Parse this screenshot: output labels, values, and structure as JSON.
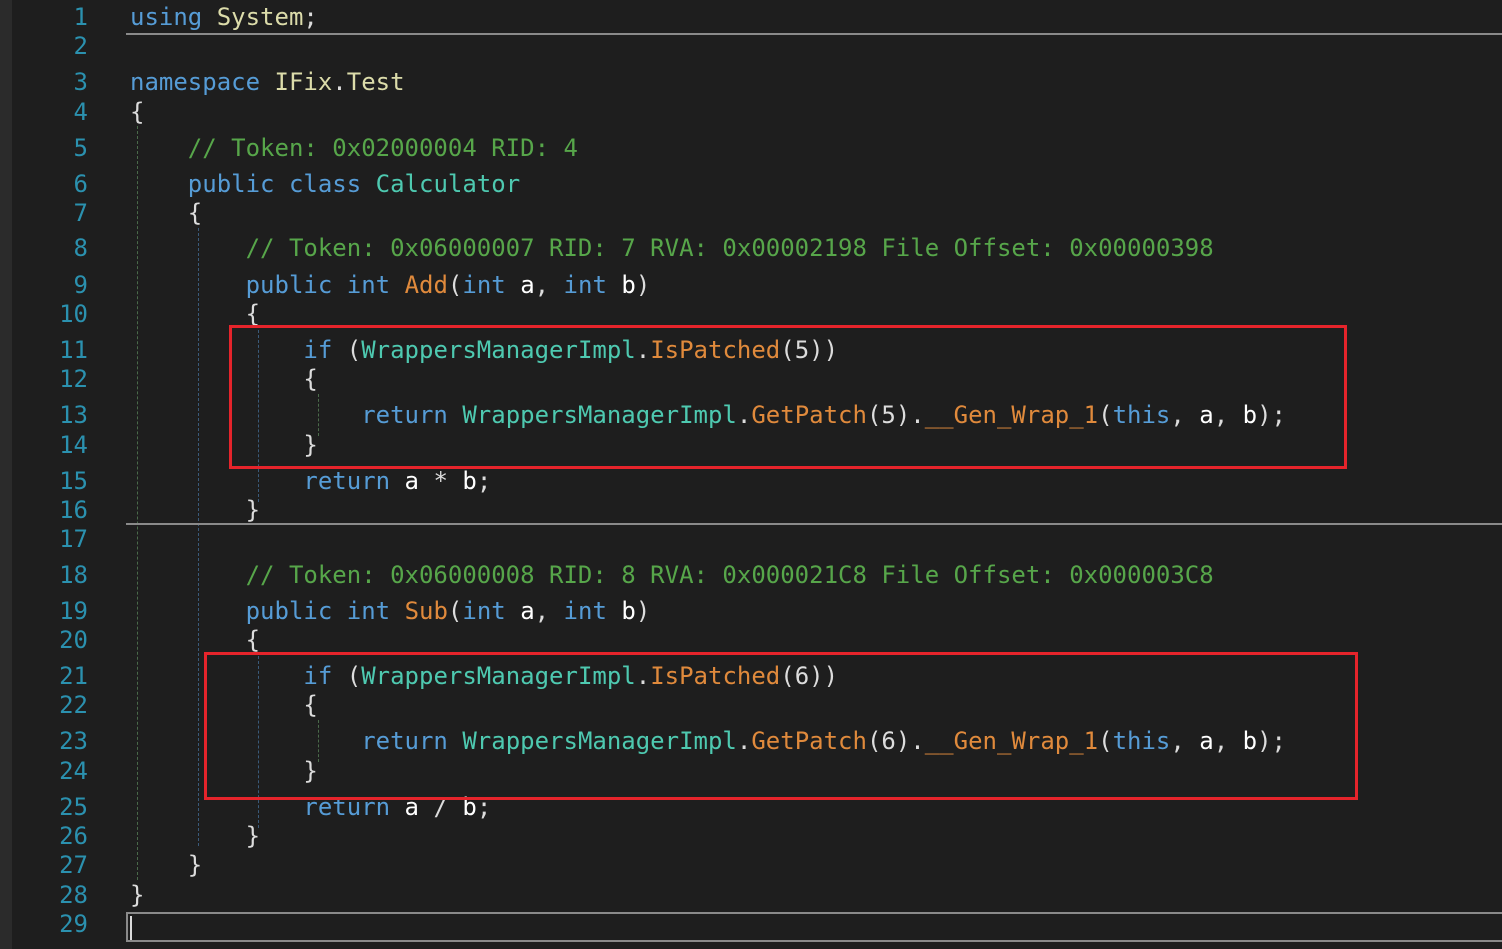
{
  "editor": {
    "line_numbers": [
      "1",
      "2",
      "3",
      "4",
      "5",
      "6",
      "7",
      "8",
      "9",
      "10",
      "11",
      "12",
      "13",
      "14",
      "15",
      "16",
      "17",
      "18",
      "19",
      "20",
      "21",
      "22",
      "23",
      "24",
      "25",
      "26",
      "27",
      "28",
      "29"
    ],
    "lines": [
      [
        {
          "t": "using",
          "c": "kw"
        },
        {
          "t": " "
        },
        {
          "t": "System",
          "c": "ns"
        },
        {
          "t": ";"
        }
      ],
      [],
      [
        {
          "t": "namespace",
          "c": "kw"
        },
        {
          "t": " "
        },
        {
          "t": "IFix",
          "c": "ns"
        },
        {
          "t": "."
        },
        {
          "t": "Test",
          "c": "ns"
        }
      ],
      [
        {
          "t": "{"
        }
      ],
      [
        {
          "t": "    "
        },
        {
          "t": "// Token: 0x02000004 RID: 4",
          "c": "cm"
        }
      ],
      [
        {
          "t": "    "
        },
        {
          "t": "public",
          "c": "kw"
        },
        {
          "t": " "
        },
        {
          "t": "class",
          "c": "kw"
        },
        {
          "t": " "
        },
        {
          "t": "Calculator",
          "c": "ty"
        }
      ],
      [
        {
          "t": "    {"
        }
      ],
      [
        {
          "t": "        "
        },
        {
          "t": "// Token: 0x06000007 RID: 7 RVA: 0x00002198 File Offset: 0x00000398",
          "c": "cm"
        }
      ],
      [
        {
          "t": "        "
        },
        {
          "t": "public",
          "c": "kw"
        },
        {
          "t": " "
        },
        {
          "t": "int",
          "c": "kw"
        },
        {
          "t": " "
        },
        {
          "t": "Add",
          "c": "fn"
        },
        {
          "t": "("
        },
        {
          "t": "int",
          "c": "kw"
        },
        {
          "t": " "
        },
        {
          "t": "a",
          "c": "pm"
        },
        {
          "t": ", "
        },
        {
          "t": "int",
          "c": "kw"
        },
        {
          "t": " "
        },
        {
          "t": "b",
          "c": "pm"
        },
        {
          "t": ")"
        }
      ],
      [
        {
          "t": "        {"
        }
      ],
      [
        {
          "t": "            "
        },
        {
          "t": "if",
          "c": "kw"
        },
        {
          "t": " ("
        },
        {
          "t": "WrappersManagerImpl",
          "c": "ty"
        },
        {
          "t": "."
        },
        {
          "t": "IsPatched",
          "c": "fn"
        },
        {
          "t": "(5))"
        }
      ],
      [
        {
          "t": "            {"
        }
      ],
      [
        {
          "t": "                "
        },
        {
          "t": "return",
          "c": "kw"
        },
        {
          "t": " "
        },
        {
          "t": "WrappersManagerImpl",
          "c": "ty"
        },
        {
          "t": "."
        },
        {
          "t": "GetPatch",
          "c": "fn"
        },
        {
          "t": "(5)."
        },
        {
          "t": "__Gen_Wrap_1",
          "c": "fn"
        },
        {
          "t": "("
        },
        {
          "t": "this",
          "c": "kw"
        },
        {
          "t": ", "
        },
        {
          "t": "a",
          "c": "pm"
        },
        {
          "t": ", "
        },
        {
          "t": "b",
          "c": "pm"
        },
        {
          "t": ");"
        }
      ],
      [
        {
          "t": "            }"
        }
      ],
      [
        {
          "t": "            "
        },
        {
          "t": "return",
          "c": "kw"
        },
        {
          "t": " "
        },
        {
          "t": "a",
          "c": "pm"
        },
        {
          "t": " * "
        },
        {
          "t": "b",
          "c": "pm"
        },
        {
          "t": ";"
        }
      ],
      [
        {
          "t": "        }"
        }
      ],
      [],
      [
        {
          "t": "        "
        },
        {
          "t": "// Token: 0x06000008 RID: 8 RVA: 0x000021C8 File Offset: 0x000003C8",
          "c": "cm"
        }
      ],
      [
        {
          "t": "        "
        },
        {
          "t": "public",
          "c": "kw"
        },
        {
          "t": " "
        },
        {
          "t": "int",
          "c": "kw"
        },
        {
          "t": " "
        },
        {
          "t": "Sub",
          "c": "fn"
        },
        {
          "t": "("
        },
        {
          "t": "int",
          "c": "kw"
        },
        {
          "t": " "
        },
        {
          "t": "a",
          "c": "pm"
        },
        {
          "t": ", "
        },
        {
          "t": "int",
          "c": "kw"
        },
        {
          "t": " "
        },
        {
          "t": "b",
          "c": "pm"
        },
        {
          "t": ")"
        }
      ],
      [
        {
          "t": "        {"
        }
      ],
      [
        {
          "t": "            "
        },
        {
          "t": "if",
          "c": "kw"
        },
        {
          "t": " ("
        },
        {
          "t": "WrappersManagerImpl",
          "c": "ty"
        },
        {
          "t": "."
        },
        {
          "t": "IsPatched",
          "c": "fn"
        },
        {
          "t": "(6))"
        }
      ],
      [
        {
          "t": "            {"
        }
      ],
      [
        {
          "t": "                "
        },
        {
          "t": "return",
          "c": "kw"
        },
        {
          "t": " "
        },
        {
          "t": "WrappersManagerImpl",
          "c": "ty"
        },
        {
          "t": "."
        },
        {
          "t": "GetPatch",
          "c": "fn"
        },
        {
          "t": "(6)."
        },
        {
          "t": "__Gen_Wrap_1",
          "c": "fn"
        },
        {
          "t": "("
        },
        {
          "t": "this",
          "c": "kw"
        },
        {
          "t": ", "
        },
        {
          "t": "a",
          "c": "pm"
        },
        {
          "t": ", "
        },
        {
          "t": "b",
          "c": "pm"
        },
        {
          "t": ");"
        }
      ],
      [
        {
          "t": "            }"
        }
      ],
      [
        {
          "t": "            "
        },
        {
          "t": "return",
          "c": "kw"
        },
        {
          "t": " "
        },
        {
          "t": "a",
          "c": "pm"
        },
        {
          "t": " / "
        },
        {
          "t": "b",
          "c": "pm"
        },
        {
          "t": ";"
        }
      ],
      [
        {
          "t": "        }"
        }
      ],
      [
        {
          "t": "    }"
        }
      ],
      [
        {
          "t": "}"
        }
      ],
      []
    ]
  },
  "highlights": [
    "add-method-patch-check",
    "sub-method-patch-check"
  ],
  "colors": {
    "background": "#1e1e1e",
    "line_number": "#2b91af",
    "keyword": "#569cd6",
    "type": "#4ec9b0",
    "namespace": "#dcdcaa",
    "method": "#e08a3c",
    "comment": "#57a64a",
    "highlight_border": "#e5242b"
  }
}
